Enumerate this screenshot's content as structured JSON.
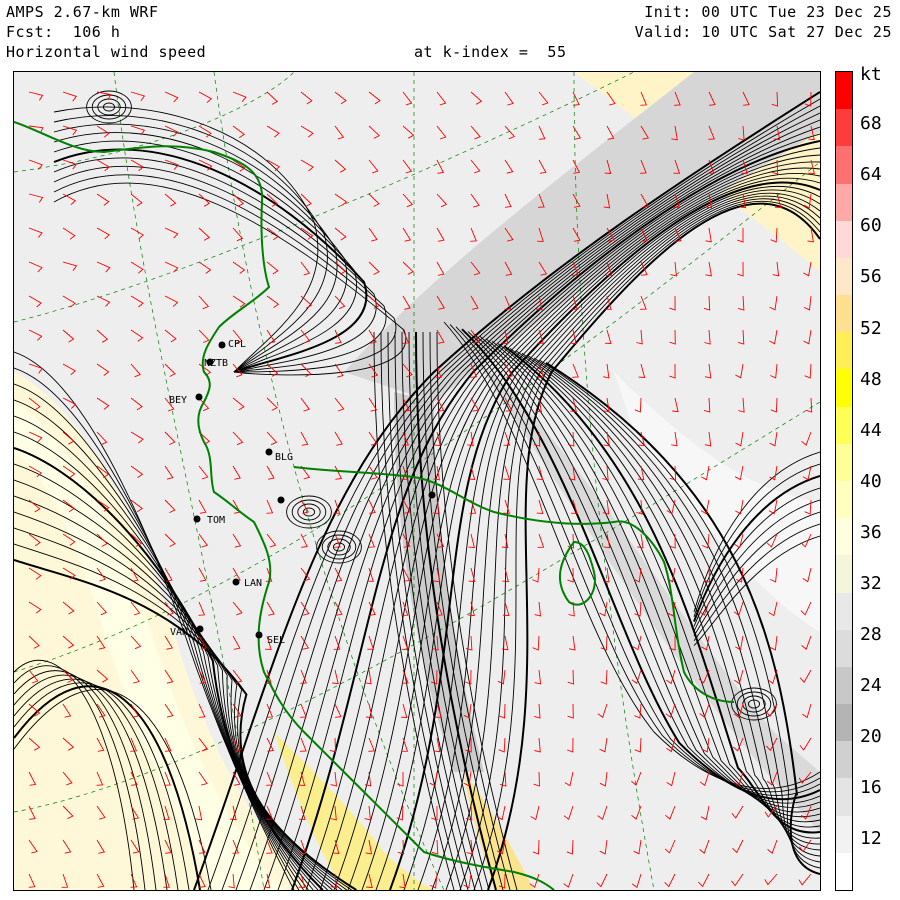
{
  "header": {
    "model": "AMPS 2.67-km WRF",
    "forecast": "Fcst:  106 h",
    "field": "Horizontal wind speed",
    "level": "at k-index =  55",
    "init": "Init: 00 UTC Tue 23 Dec 25",
    "valid": "Valid: 10 UTC Sat 27 Dec 25"
  },
  "colorbar": {
    "unit": "kt",
    "labels": [
      "68",
      "64",
      "60",
      "56",
      "52",
      "48",
      "44",
      "40",
      "36",
      "32",
      "28",
      "24",
      "20",
      "16",
      "12"
    ],
    "colors": [
      "#ff0000",
      "#ff3c3c",
      "#ff7070",
      "#ffa8a8",
      "#ffd8d8",
      "#ffe8c8",
      "#ffdf90",
      "#ffee55",
      "#ffff00",
      "#ffff55",
      "#ffff99",
      "#ffffc0",
      "#ffffe0",
      "#f5f5dc",
      "#e8e8e8",
      "#dcdcdc",
      "#c8c8c8",
      "#b4b4b4",
      "#d0d0d0",
      "#e4e4e4",
      "#f2f2f2",
      "#ffffff"
    ]
  },
  "stations": [
    {
      "name": "CPL"
    },
    {
      "name": "NZTB"
    },
    {
      "name": "BEY"
    },
    {
      "name": "BLG"
    },
    {
      "name": "TOM"
    },
    {
      "name": "LAN"
    },
    {
      "name": "VAN"
    },
    {
      "name": "SEL"
    }
  ],
  "colors": {
    "coast": "#008000",
    "streamline": "#000000",
    "barb": "#ff0000",
    "grid": "#008000"
  }
}
